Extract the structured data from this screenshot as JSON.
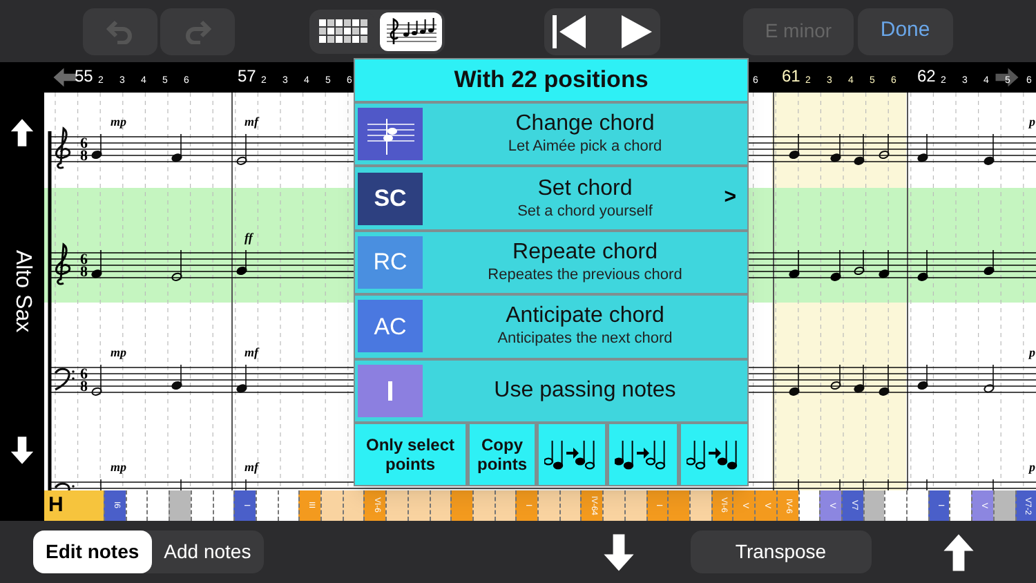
{
  "toolbar": {
    "undo": {
      "disabled": true
    },
    "redo": {
      "disabled": true
    },
    "views": [
      {
        "kind": "piano_roll",
        "selected": false
      },
      {
        "kind": "score",
        "selected": true
      }
    ],
    "key_button": {
      "label": "E minor",
      "disabled": true
    },
    "done_button": {
      "label": "Done"
    }
  },
  "ruler": {
    "measures": [
      {
        "number": "55",
        "selected": false,
        "beats": [
          "2",
          "3",
          "4",
          "5",
          "6"
        ]
      },
      {
        "number": "57",
        "selected": false,
        "beats": [
          "2",
          "3",
          "4",
          "5",
          "6"
        ]
      },
      {
        "selected": false,
        "beats": [
          "6"
        ]
      },
      {
        "number": "61",
        "selected": true,
        "beats": [
          "2",
          "3",
          "4",
          "5",
          "6"
        ]
      },
      {
        "number": "62",
        "selected": false,
        "beats": [
          "2",
          "3",
          "4",
          "5",
          "6"
        ]
      }
    ]
  },
  "track": {
    "name": "Alto Sax"
  },
  "score": {
    "staves": [
      {
        "kind": "treble",
        "highlighted": false,
        "time": [
          "6",
          "8"
        ],
        "dynamics": [
          "mp",
          "mf",
          "p"
        ]
      },
      {
        "kind": "treble",
        "highlighted": true,
        "time": [
          "6",
          "8"
        ],
        "dynamics": [
          "ff"
        ]
      },
      {
        "kind": "bass",
        "highlighted": false,
        "time": [
          "6",
          "8"
        ],
        "dynamics": [
          "mp",
          "mf",
          "p"
        ]
      },
      {
        "kind": "bass",
        "highlighted": false,
        "dynamics": [
          "mp",
          "mf",
          "p"
        ]
      }
    ]
  },
  "chord_strip": {
    "section": "H",
    "cells": [
      {
        "color": "#4a5fc9",
        "label": "I6"
      },
      {
        "color": "#ffffff"
      },
      {
        "color": "#ffffff"
      },
      {
        "color": "#b8b8b8"
      },
      {
        "color": "#ffffff"
      },
      {
        "color": "#ffffff"
      },
      {
        "color": "#4a5fc9",
        "label": "I"
      },
      {
        "color": "#ffffff"
      },
      {
        "color": "#ffffff"
      },
      {
        "color": "#f39a1e",
        "label": "III"
      },
      {
        "color": "#f9d3a0"
      },
      {
        "color": "#f9d3a0"
      },
      {
        "color": "#f39a1e",
        "label": "VI-6"
      },
      {
        "color": "#f9d3a0"
      },
      {
        "color": "#f9d3a0"
      },
      {
        "color": "#f9d3a0"
      },
      {
        "color": "#f39a1e"
      },
      {
        "color": "#f9d3a0"
      },
      {
        "color": "#f9d3a0"
      },
      {
        "color": "#f39a1e",
        "label": "I"
      },
      {
        "color": "#f9d3a0"
      },
      {
        "color": "#f9d3a0"
      },
      {
        "color": "#f39a1e",
        "label": "IV-64"
      },
      {
        "color": "#f9d3a0"
      },
      {
        "color": "#f9d3a0"
      },
      {
        "color": "#f39a1e",
        "label": "I"
      },
      {
        "color": "#f39a1e"
      },
      {
        "color": "#f9d3a0"
      },
      {
        "color": "#f39a1e",
        "label": "VI-6"
      },
      {
        "color": "#f39a1e",
        "label": "V"
      },
      {
        "color": "#f39a1e",
        "label": "V"
      },
      {
        "color": "#f39a1e",
        "label": "IV-6"
      },
      {
        "color": "#ffffff"
      },
      {
        "color": "#8c86e0",
        "label": "V"
      },
      {
        "color": "#4a5fc9",
        "label": "V7"
      },
      {
        "color": "#b8b8b8"
      },
      {
        "color": "#ffffff"
      },
      {
        "color": "#ffffff"
      },
      {
        "color": "#4a5fc9",
        "label": "I"
      },
      {
        "color": "#ffffff"
      },
      {
        "color": "#8c86e0",
        "label": "V"
      },
      {
        "color": "#b8b8b8"
      },
      {
        "color": "#4a5fc9",
        "label": "V7-2"
      }
    ]
  },
  "popup": {
    "title": "With 22 positions",
    "items": [
      {
        "kind": "drawing",
        "color": "#5058c8",
        "title": "Change chord",
        "subtitle": "Let Aimée pick a chord"
      },
      {
        "kind": "abbr",
        "color": "#2d4080",
        "abbr": "SC",
        "title": "Set chord",
        "subtitle": "Set a chord yourself",
        "arrow": ">"
      },
      {
        "kind": "abbr",
        "color": "#4a8fe0",
        "abbr": "RC",
        "title": "Repeate chord",
        "subtitle": "Repeates the previous chord"
      },
      {
        "kind": "abbr",
        "color": "#4a78e0",
        "abbr": "AC",
        "title": "Anticipate chord",
        "subtitle": "Anticipates the next chord"
      },
      {
        "kind": "bar",
        "color": "#8c7fe0",
        "title": "Use passing notes"
      }
    ],
    "buttons": [
      "Only select points",
      "Copy points"
    ]
  },
  "bottom_bar": {
    "modes": [
      {
        "label": "Edit notes",
        "selected": true
      },
      {
        "label": "Add notes",
        "selected": false
      }
    ],
    "transpose": "Transpose"
  }
}
